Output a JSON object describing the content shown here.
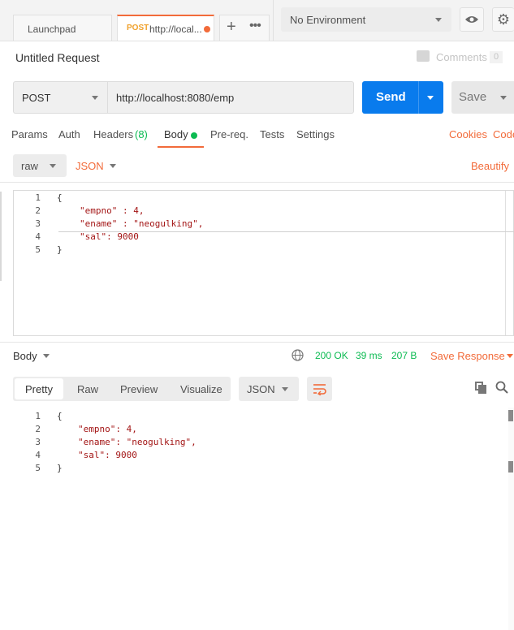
{
  "tabs": [
    {
      "label": "Launchpad"
    },
    {
      "method": "POST",
      "label": "http://local..."
    }
  ],
  "environment": {
    "selected": "No Environment"
  },
  "request": {
    "title": "Untitled Request",
    "comments_label": "Comments",
    "comments_count": "0",
    "method": "POST",
    "url": "http://localhost:8080/emp",
    "send_label": "Send",
    "save_label": "Save"
  },
  "request_tabs": {
    "params": "Params",
    "auth": "Auth",
    "headers": "Headers",
    "headers_count": "(8)",
    "body": "Body",
    "prereq": "Pre-req.",
    "tests": "Tests",
    "settings": "Settings",
    "cookies": "Cookies",
    "code": "Code"
  },
  "body_options": {
    "mode": "raw",
    "language": "JSON",
    "beautify": "Beautify"
  },
  "request_body": {
    "line_numbers": [
      "1",
      "2",
      "3",
      "4",
      "5"
    ],
    "lines": [
      "{",
      "\"empno\" : 4,",
      "\"ename\" : \"neogulking\",",
      "\"sal\": 9000",
      "}"
    ]
  },
  "response": {
    "section_label": "Body",
    "status": "200 OK",
    "time": "39 ms",
    "size": "207 B",
    "save_response": "Save Response",
    "view_modes": [
      "Pretty",
      "Raw",
      "Preview",
      "Visualize"
    ],
    "format": "JSON",
    "line_numbers": [
      "1",
      "2",
      "3",
      "4",
      "5"
    ],
    "lines": [
      "{",
      "\"empno\": 4,",
      "\"ename\": \"neogulking\",",
      "\"sal\": 9000",
      "}"
    ]
  },
  "colors": {
    "accent": "#f26b3a",
    "send": "#097bed",
    "status_ok": "#0cbb52",
    "active_dot": "#0cbb52"
  }
}
